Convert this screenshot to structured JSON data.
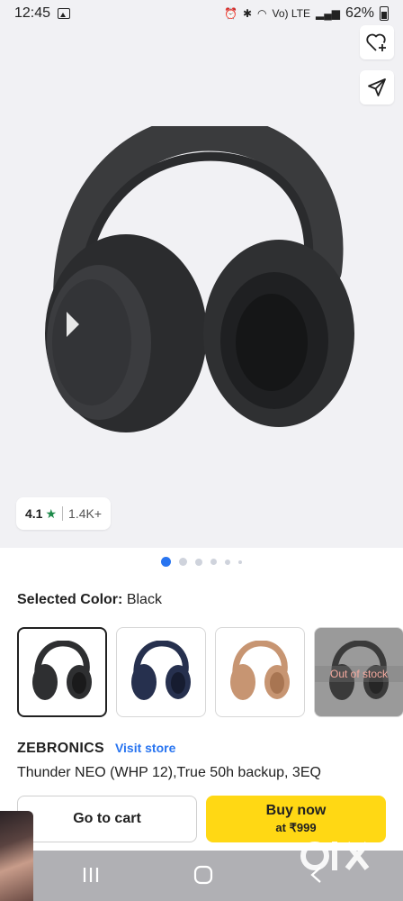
{
  "status": {
    "time": "12:45",
    "network": "Vo) LTE",
    "battery_percent": "62%"
  },
  "product_image": {
    "wishlist_icon": "heart-plus-icon",
    "share_icon": "send-icon",
    "rating": "4.1",
    "rating_star": "★",
    "rating_count": "1.4K+"
  },
  "carousel": {
    "total": 6,
    "active_index": 0,
    "colors": {
      "active": "#2874f0",
      "inactive": "#cfd3dc"
    }
  },
  "color_selector": {
    "label": "Selected Color:",
    "value": "Black",
    "options": [
      {
        "color": "#2e2f31",
        "selected": true
      },
      {
        "color": "#26304e",
        "selected": false
      },
      {
        "color": "#c79572",
        "selected": false
      },
      {
        "color": "#3a3a3a",
        "selected": false,
        "out_of_stock_label": "Out of stock"
      }
    ]
  },
  "product": {
    "brand": "ZEBRONICS",
    "visit_store": "Visit store",
    "title": "Thunder NEO (WHP 12),True 50h backup, 3EQ"
  },
  "actions": {
    "go_to_cart": "Go to cart",
    "buy_now": "Buy now",
    "buy_now_price": "at ₹999"
  },
  "watermark": "OLX",
  "colors": {
    "accent": "#2874f0",
    "buy": "#ffd814",
    "rating_star": "#1d8a4a"
  }
}
